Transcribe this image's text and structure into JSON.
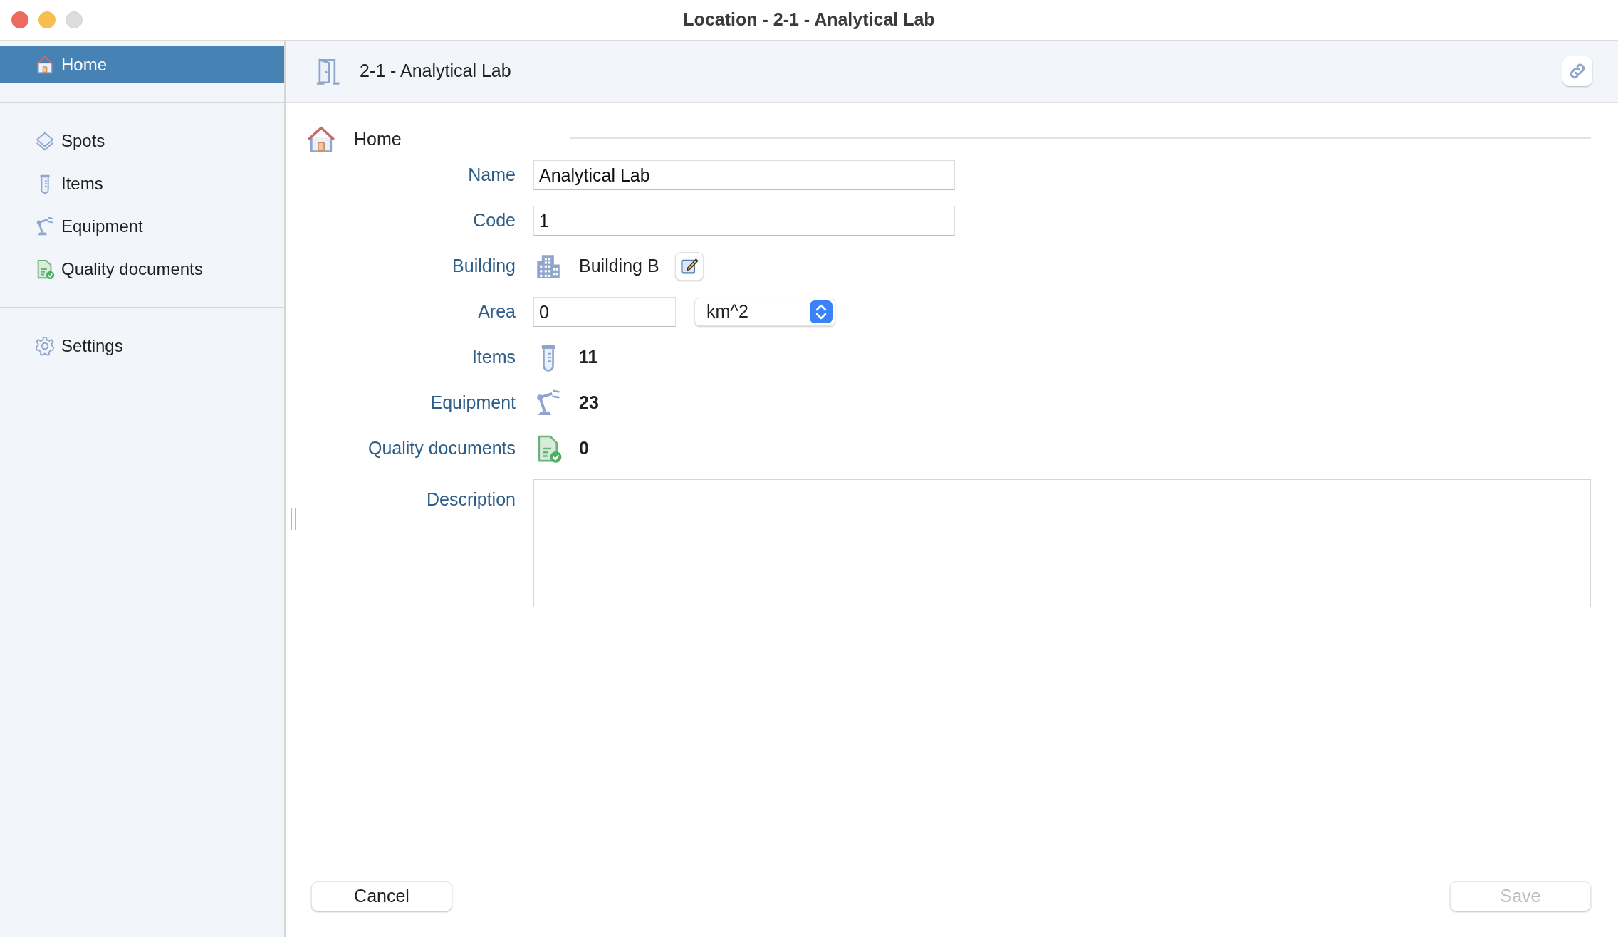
{
  "window": {
    "title": "Location - 2-1 - Analytical Lab"
  },
  "sidebar": {
    "groups": [
      [
        {
          "label": "Home",
          "selected": true
        }
      ],
      [
        {
          "label": "Spots",
          "selected": false
        },
        {
          "label": "Items",
          "selected": false
        },
        {
          "label": "Equipment",
          "selected": false
        },
        {
          "label": "Quality documents",
          "selected": false
        }
      ],
      [
        {
          "label": "Settings",
          "selected": false
        }
      ]
    ]
  },
  "header": {
    "title": "2-1 - Analytical Lab"
  },
  "section": {
    "title": "Home"
  },
  "form": {
    "rows": [
      {
        "kind": "text",
        "label": "Name",
        "value": "Analytical Lab"
      },
      {
        "kind": "text",
        "label": "Code",
        "value": "1"
      },
      {
        "kind": "link",
        "label": "Building",
        "value": "Building B"
      },
      {
        "kind": "area",
        "label": "Area",
        "value": "0",
        "unit": "km^2"
      },
      {
        "kind": "count",
        "label": "Items",
        "value": "11"
      },
      {
        "kind": "count",
        "label": "Equipment",
        "value": "23"
      },
      {
        "kind": "count",
        "label": "Quality documents",
        "value": "0"
      },
      {
        "kind": "textarea",
        "label": "Description"
      }
    ]
  },
  "buttons": [
    {
      "label": "Cancel",
      "disabled": false
    },
    {
      "label": "Save",
      "disabled": true
    }
  ]
}
